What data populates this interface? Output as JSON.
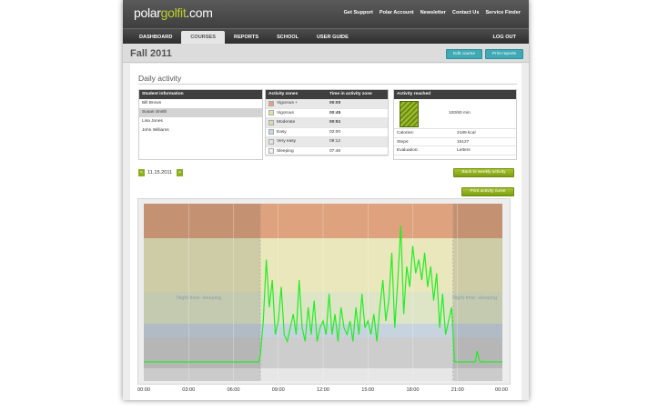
{
  "header": {
    "logo_part1": "polar",
    "logo_part2": "golfit",
    "logo_part3": ".com",
    "links": [
      "Get Support",
      "Polar Account",
      "Newsletter",
      "Contact Us",
      "Service Finder"
    ]
  },
  "nav": {
    "tabs": [
      {
        "label": "DASHBOARD",
        "active": false
      },
      {
        "label": "COURSES",
        "active": true
      },
      {
        "label": "REPORTS",
        "active": false
      },
      {
        "label": "SCHOOL",
        "active": false
      },
      {
        "label": "USER GUIDE",
        "active": false
      }
    ],
    "logout": "LOG OUT"
  },
  "page": {
    "title": "Fall 2011",
    "edit_button": "Edit course",
    "print_button": "Print reports",
    "section_title": "Daily activity"
  },
  "students": {
    "header": "Student information",
    "items": [
      "Bill Brown",
      "Susan Smith",
      "Lisa Jones",
      "John Williams"
    ],
    "selected": "Susan Smith"
  },
  "zones": {
    "col1": "Activity zones",
    "col2": "Time in activity zone",
    "rows": [
      {
        "name": "Vigorous +",
        "time": "00:00",
        "color": "#e8a07c"
      },
      {
        "name": "Vigorous",
        "time": "00:45",
        "color": "#dfe6a0"
      },
      {
        "name": "Moderate",
        "time": "00:51",
        "color": "#d4e0b0"
      },
      {
        "name": "Easy",
        "time": "02:00",
        "color": "#c9d6e4"
      },
      {
        "name": "Very easy",
        "time": "09:12",
        "color": "#e4e4e4"
      },
      {
        "name": "Sleeping",
        "time": "07:48",
        "color": "#f2f2f2"
      }
    ]
  },
  "reached": {
    "header": "Activity reached",
    "value": "100/60 min",
    "rows": [
      {
        "label": "Calories:",
        "value": "2189 kcal"
      },
      {
        "label": "Steps:",
        "value": "15127"
      },
      {
        "label": "Evaluation:",
        "value": "Letters"
      }
    ]
  },
  "date_nav": {
    "prev": "<",
    "date": "11.15.2011",
    "next": ">",
    "weekly_button": "Back to weekly activity",
    "print_curve_button": "Print activity curve"
  },
  "chart_data": {
    "type": "line",
    "x_ticks": [
      "00:00",
      "03:00",
      "06:00",
      "09:00",
      "12:00",
      "15:00",
      "18:00",
      "21:00",
      "00:00"
    ],
    "band_labels": [
      "Night time: sleeping",
      "Night time: sleeping"
    ],
    "night_shading_hours": [
      [
        0,
        7.8
      ],
      [
        20.7,
        24
      ]
    ],
    "zone_colors": [
      "#dea27e",
      "#e9e7bb",
      "#dde5c6",
      "#c7d3df",
      "#cdcdcd"
    ],
    "line_color": "#22ee22",
    "series": [
      {
        "x": [
          0,
          7.7,
          7.8,
          8.0,
          8.2,
          8.4,
          8.6,
          8.8,
          9.0,
          9.2,
          9.4,
          9.6,
          9.8,
          10.0,
          10.2,
          10.4,
          10.6,
          10.8,
          11.0,
          11.2,
          11.4,
          11.6,
          11.8,
          12.0,
          12.2,
          12.4,
          12.6,
          12.8,
          13.0,
          13.2,
          13.4,
          13.6,
          13.8,
          14.0,
          14.2,
          14.4,
          14.6,
          14.8,
          15.0,
          15.2,
          15.4,
          15.6,
          15.8,
          16.0,
          16.2,
          16.4,
          16.6,
          16.8,
          17.0,
          17.2,
          17.4,
          17.6,
          17.8,
          18.0,
          18.2,
          18.4,
          18.6,
          18.8,
          19.0,
          19.2,
          19.4,
          19.6,
          19.8,
          20.0,
          20.2,
          20.4,
          20.6,
          20.8,
          21.0,
          21.5,
          22.0,
          22.2,
          22.3,
          22.5,
          24
        ],
        "y": [
          0,
          0,
          5,
          30,
          75,
          40,
          60,
          20,
          30,
          55,
          20,
          15,
          25,
          35,
          20,
          60,
          25,
          15,
          40,
          20,
          45,
          15,
          25,
          30,
          20,
          50,
          20,
          35,
          15,
          40,
          25,
          20,
          30,
          15,
          40,
          20,
          50,
          25,
          30,
          20,
          35,
          15,
          40,
          60,
          30,
          45,
          80,
          25,
          60,
          100,
          35,
          70,
          55,
          85,
          65,
          75,
          60,
          80,
          55,
          70,
          45,
          65,
          25,
          50,
          20,
          30,
          40,
          0,
          0,
          0,
          0,
          0,
          8,
          0,
          0
        ]
      }
    ]
  }
}
